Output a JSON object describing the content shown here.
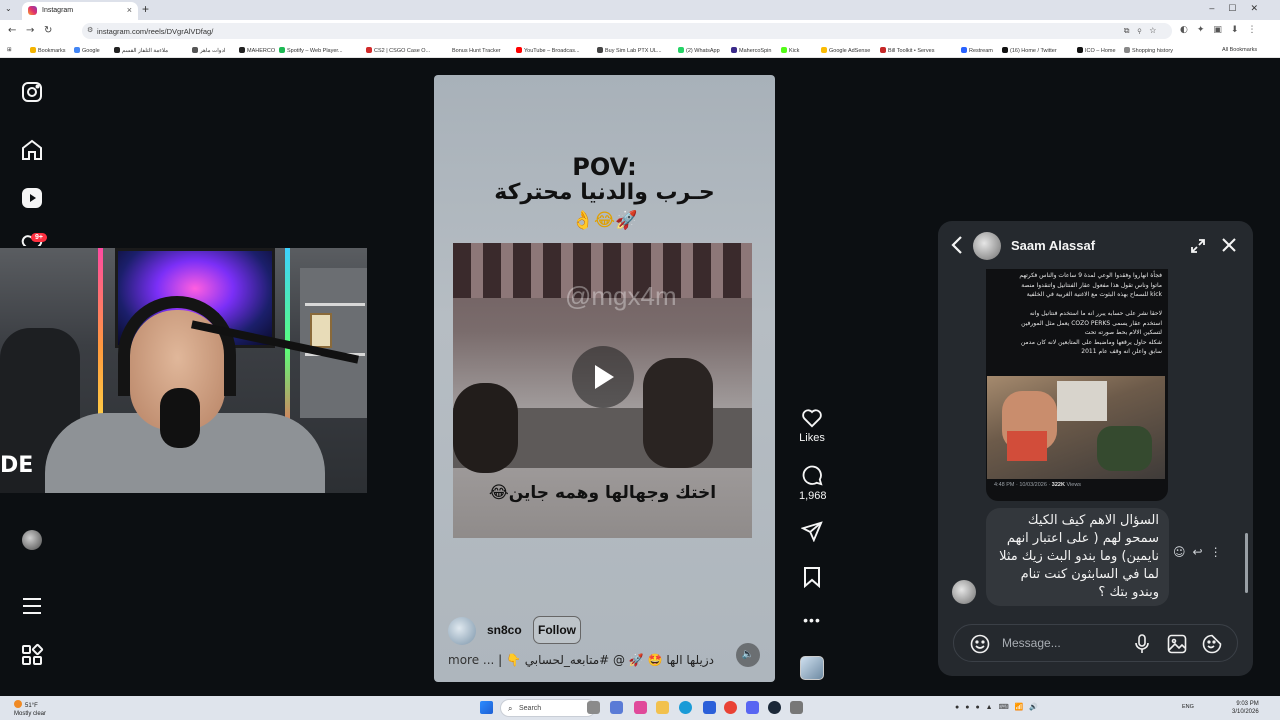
{
  "browser": {
    "tab_title": "Instagram",
    "url": "instagram.com/reels/DVgrAlVDfag/",
    "bookmarks_label": "All Bookmarks",
    "bookmarks": [
      {
        "label": "Bookmarks",
        "color": "#f4b400"
      },
      {
        "label": "Google",
        "color": "#4285f4"
      },
      {
        "label": "ملاءمة التلفاز القسم",
        "color": "#222222"
      },
      {
        "label": "ادوات ماهر",
        "color": "#555555"
      },
      {
        "label": "MAHERCO",
        "color": "#222222"
      },
      {
        "label": "Spotify – Web Player...",
        "color": "#1db954"
      },
      {
        "label": "CS2 | CSGO Case O...",
        "color": "#d12a2a"
      },
      {
        "label": "Bonus Hunt Tracker",
        "color": "#ffffff"
      },
      {
        "label": "YouTube – Broadcas...",
        "color": "#ff0000"
      },
      {
        "label": "Buy Sim Lab PTX UL...",
        "color": "#444444"
      },
      {
        "label": "(2) WhatsApp",
        "color": "#25d366"
      },
      {
        "label": "MahercoSpin",
        "color": "#3a2a8a"
      },
      {
        "label": "Kick",
        "color": "#53fc18"
      },
      {
        "label": "Google AdSense",
        "color": "#fbbc04"
      },
      {
        "label": "Bill Toolkit • Serves",
        "color": "#c62828"
      },
      {
        "label": "Restream",
        "color": "#2962ff"
      },
      {
        "label": "(16) Home / Twitter",
        "color": "#111111"
      },
      {
        "label": "ICO – Home",
        "color": "#111111"
      },
      {
        "label": "Shopping history",
        "color": "#888888"
      }
    ]
  },
  "ig_nav": {
    "notifications_badge": "9+",
    "items": [
      "instagram-logo-icon",
      "home-icon",
      "reels-icon",
      "heart-icon",
      "messages-icon",
      "profile-avatar",
      "menu-icon",
      "more-apps-icon"
    ]
  },
  "webcam": {
    "shirt_text": "DE"
  },
  "reel": {
    "title_line1": "POV:",
    "title_line2": "حـرب والدنيا محتركة",
    "title_emojis": "👌😂🚀",
    "watermark": "@mgx4m",
    "video_caption": "اختك وجهالها وهمه جاين😂",
    "username": "sn8co",
    "follow_label": "Follow",
    "caption": "دزيلها الها 🤩 🚀 @ #متابعه_لحسابي 👇 |",
    "caption_more": "more ...",
    "likes_label": "Likes",
    "comments_count": "1,968"
  },
  "chat": {
    "name": "Saam Alassaf",
    "shared_text": "فجأة انهاروا وفقدوا الوعي لمدة 9 ساعات والناس فكرتهم\nماتوا وناس تقول هذا مفعول عقار الفنتانيل واتنقدوا منصة\nkick للسماح بهذه البثوث مع الاغنية الغربية في الخلفية\n\nلاحقا نشر على حسابه يبرر انه ما استخدم فنتانيل وانه\nاستخدم عقار يسمى COZO PERKS يعمل مثل المورفين\nلتسكين الالام بحط صورته تحت\nشكله حاول يرقعها وماضبط على المتابعين لانه كان مدمن\nسابق واعلن انه وقف عام 2011",
    "shared_time": "4:48 PM · 10/03/2026 ·",
    "shared_views": "322K",
    "shared_views_label": "Views",
    "message": "السؤال الاهم كيف الكيك سمحو لهم ( على اعتبار انهم نايمين) وما بندو البث زيك مثلا لما في السابثون كنت تنام وبندو بتك ؟",
    "composer_placeholder": "Message..."
  },
  "taskbar": {
    "weather_temp": "51°F",
    "weather_desc": "Mostly clear",
    "search_label": "Search",
    "lang": "ENG",
    "time": "9:03 PM",
    "date": "3/10/2026"
  }
}
